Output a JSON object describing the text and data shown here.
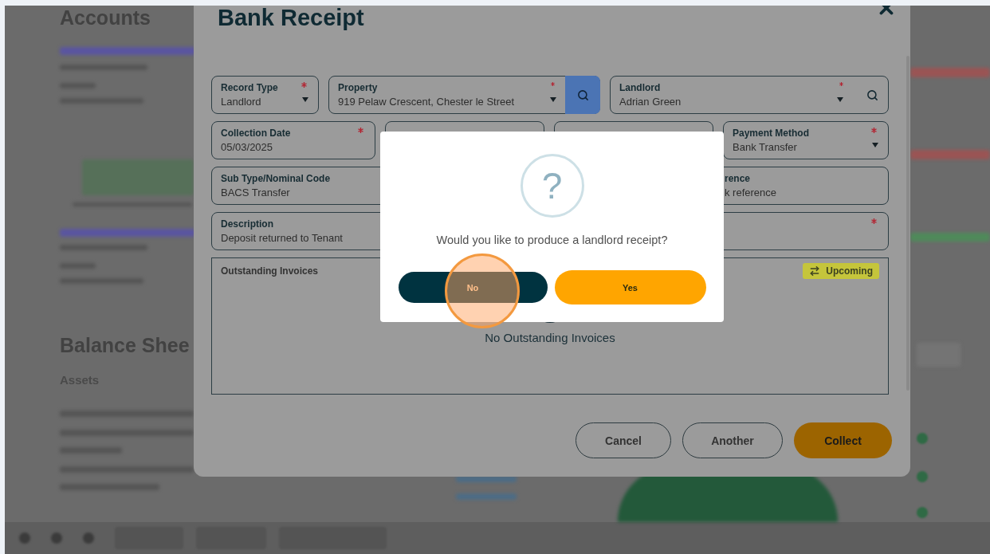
{
  "background": {
    "accounts_heading": "Accounts",
    "balance_heading": "Balance Shee",
    "assets_label": "Assets"
  },
  "modal": {
    "title": "Bank Receipt",
    "rows": [
      {
        "fields": [
          {
            "kind": "select",
            "label": "Record Type",
            "value": "Landlord",
            "required": true
          },
          {
            "kind": "lookup",
            "label": "Property",
            "value": "919 Pelaw Crescent, Chester le Street",
            "required": true
          },
          {
            "kind": "search",
            "label": "Landlord",
            "value": "Adrian Green",
            "required": true
          }
        ]
      },
      {
        "fields": [
          {
            "kind": "text",
            "label": "Collection Date",
            "value": "05/03/2025",
            "required": true
          },
          {
            "kind": "text",
            "required": false
          },
          {
            "kind": "text",
            "required": false
          },
          {
            "kind": "select",
            "label": "Payment Method",
            "value": "Bank Transfer",
            "required": true
          }
        ]
      },
      {
        "fields": [
          {
            "kind": "text",
            "label": "Sub Type/Nominal Code",
            "value": "BACS Transfer",
            "required": false
          },
          {
            "kind": "covered",
            "label": "rence",
            "value": "k reference",
            "required": false
          }
        ]
      },
      {
        "fields": [
          {
            "kind": "text",
            "label": "Description",
            "value": "Deposit returned to Tenant",
            "required": false
          },
          {
            "kind": "text",
            "required": true
          }
        ]
      }
    ],
    "invoices": {
      "title": "Outstanding Invoices",
      "badge": "Upcoming",
      "empty_text": "No Outstanding Invoices"
    },
    "buttons": [
      {
        "kind": "outline",
        "label": "Cancel"
      },
      {
        "kind": "outline",
        "label": "Another"
      },
      {
        "kind": "primary",
        "label": "Collect"
      }
    ]
  },
  "dialog": {
    "icon": "?",
    "message": "Would you like to produce a landlord receipt?",
    "buttons": [
      {
        "kind": "secondary",
        "label": "No",
        "highlighted": true
      },
      {
        "kind": "primary",
        "label": "Yes",
        "highlighted": false
      }
    ]
  }
}
